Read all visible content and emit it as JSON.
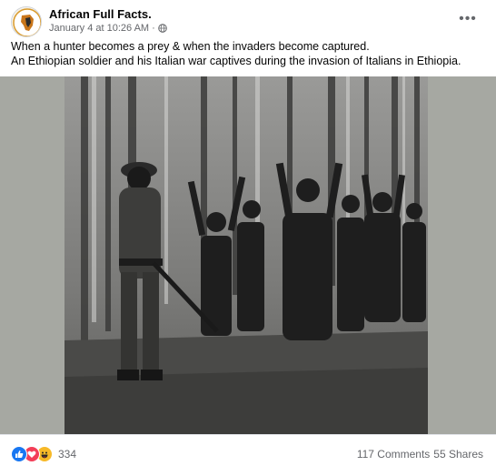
{
  "post": {
    "page_name": "African Full Facts.",
    "timestamp": "January 4 at 10:26 AM",
    "separator": "·",
    "privacy_icon": "globe-icon",
    "more_icon": "more-options-icon",
    "more_label": "•••",
    "caption_lines": [
      "When a hunter becomes a prey & when the invaders become captured.",
      "An Ethiopian soldier and his Italian war captives during the invasion of Italians in Ethiopia."
    ]
  },
  "footer": {
    "reaction_icons": [
      "like-icon",
      "love-icon",
      "haha-icon"
    ],
    "reaction_count": "334",
    "comments": "117 Comments",
    "shares": "55 Shares"
  },
  "colors": {
    "text": "#050505",
    "secondary": "#65676b",
    "like": "#1877f2",
    "love": "#f33e58",
    "haha": "#f7b928"
  }
}
